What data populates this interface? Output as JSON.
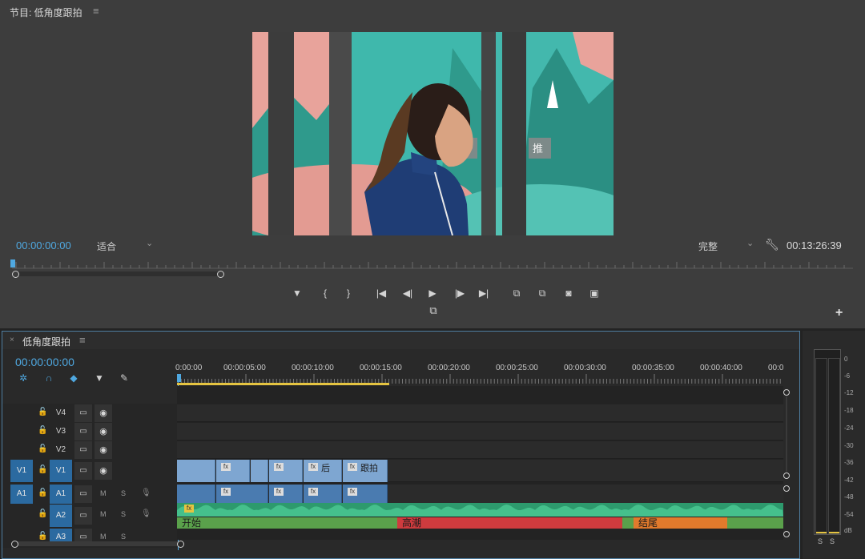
{
  "monitor": {
    "title": "节目: 低角度跟拍",
    "menu_icon": "hamburger-icon",
    "current_timecode": "00:00:00:00",
    "fit_value": "适合",
    "quality_value": "完整",
    "duration_timecode": "00:13:26:39",
    "transport_buttons": [
      "marker",
      "mark-in",
      "mark-out",
      "go-to-in",
      "step-back",
      "play",
      "step-forward",
      "go-to-out",
      "insert",
      "overwrite",
      "export-frame",
      "comparison-view"
    ],
    "transport_glyphs": [
      "▼",
      "{",
      "}",
      "|◀",
      "◀|",
      "▶",
      "|▶",
      "▶|",
      "⧉",
      "⧉",
      "◙",
      "▣"
    ]
  },
  "timeline": {
    "title": "低角度跟拍",
    "close_glyph": "×",
    "menu_glyph": "≡",
    "timecode": "00:00:00:00",
    "tools": [
      {
        "name": "snap-icon",
        "glyph": "✲",
        "color": "#4fa8e0"
      },
      {
        "name": "linked-selection-icon",
        "glyph": "∩",
        "color": "#4fa8e0"
      },
      {
        "name": "add-marker-tool-icon",
        "glyph": "◆",
        "color": "#4fa8e0"
      },
      {
        "name": "marker-icon",
        "glyph": "▼",
        "color": "#d0d0d0"
      },
      {
        "name": "wrench-icon",
        "glyph": "✎",
        "color": "#d0d0d0"
      }
    ],
    "ruler_ticks": [
      "0:00:00",
      "00:00:05:00",
      "00:00:10:00",
      "00:00:15:00",
      "00:00:20:00",
      "00:00:25:00",
      "00:00:30:00",
      "00:00:35:00",
      "00:00:40:00",
      "00:0"
    ],
    "video_tracks": [
      {
        "name": "V4",
        "target": ""
      },
      {
        "name": "V3",
        "target": ""
      },
      {
        "name": "V2",
        "target": ""
      },
      {
        "name": "V1",
        "target": "V1"
      }
    ],
    "audio_tracks": [
      {
        "name": "A1",
        "target": "A1",
        "m": "M",
        "s": "S"
      },
      {
        "name": "A2",
        "target": "",
        "m": "M",
        "s": "S"
      },
      {
        "name": "A3",
        "target": "",
        "m": "M",
        "s": "S"
      }
    ],
    "video_clip_labels": [
      "",
      "",
      "",
      "后",
      "跟拍"
    ],
    "markers": [
      {
        "label": "开始",
        "color": "#5aa14b"
      },
      {
        "label": "高潮",
        "color": "#cf3b3e"
      },
      {
        "label": "结尾",
        "color": "#e27a2c"
      }
    ],
    "fx_glyph": "fx",
    "lock_glyph": "🔓",
    "sync_glyph": "▭",
    "eye_glyph": "◉",
    "mic_glyph": "🎙"
  },
  "meter": {
    "db_labels": [
      "0",
      "-6",
      "-12",
      "-18",
      "-24",
      "-30",
      "-36",
      "-42",
      "-48",
      "-54",
      "dB"
    ],
    "solo_labels": [
      "S",
      "S"
    ],
    "peak_color": "#e5c441"
  },
  "plus_glyph": "+"
}
